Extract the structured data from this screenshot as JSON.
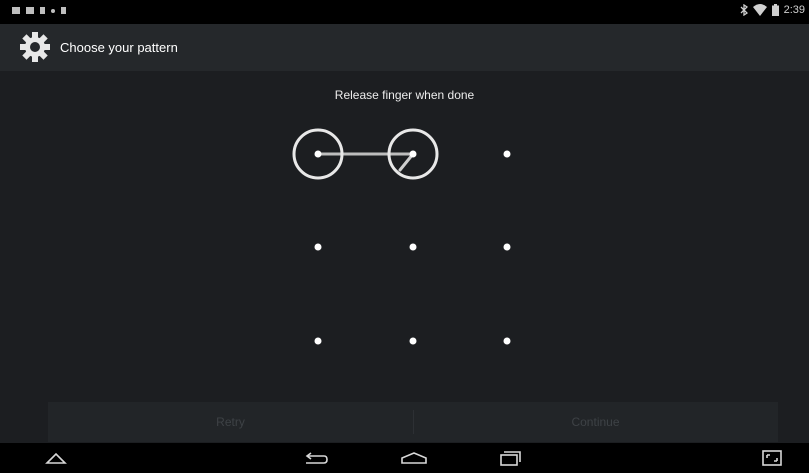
{
  "status_bar": {
    "time": "2:39",
    "left_icons": [
      "screenshot-icon",
      "gallery-icon",
      "usb-icon",
      "dot-icon",
      "download-icon"
    ],
    "right_icons": [
      "bluetooth-icon",
      "wifi-icon",
      "battery-icon"
    ]
  },
  "action_bar": {
    "title": "Choose your pattern",
    "icon": "gear-icon"
  },
  "pattern_screen": {
    "header_message": "Release finger when done",
    "grid_rows": 3,
    "grid_cols": 3,
    "selected_dots": [
      1,
      2
    ]
  },
  "buttons": {
    "retry_label": "Retry",
    "continue_label": "Continue"
  },
  "nav_bar": {
    "buttons": [
      "home-up-icon",
      "back-icon",
      "home-icon",
      "recents-icon",
      "fullscreen-icon"
    ]
  }
}
